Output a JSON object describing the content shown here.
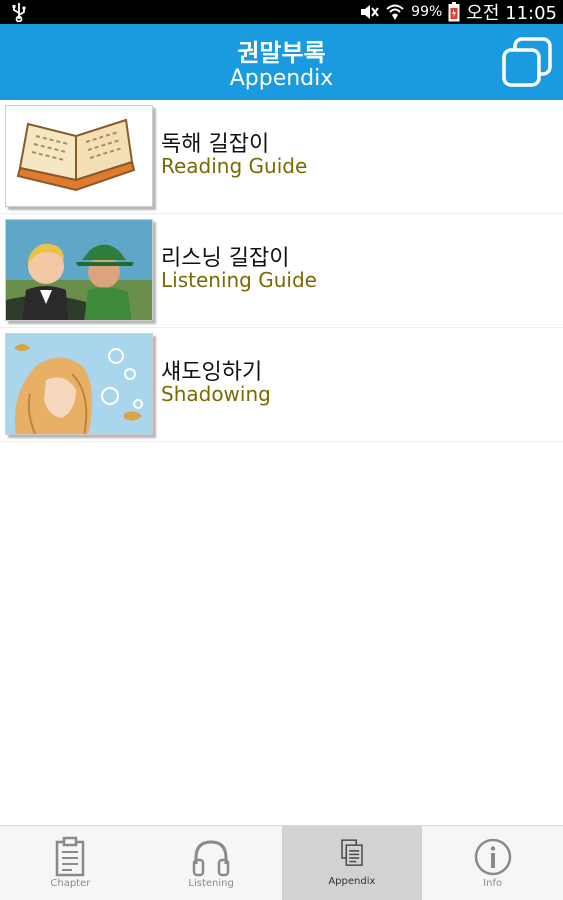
{
  "status_bar": {
    "battery_percent": "99%",
    "time": "오전 11:05",
    "icons": [
      "usb-icon",
      "mute-icon",
      "wifi-icon",
      "battery-icon"
    ]
  },
  "header": {
    "title_ko": "권말부록",
    "title_en": "Appendix",
    "action_icon": "copy-icon"
  },
  "list": {
    "items": [
      {
        "title_ko": "독해 길잡이",
        "title_en": "Reading Guide"
      },
      {
        "title_ko": "리스닝 길잡이",
        "title_en": "Listening Guide"
      },
      {
        "title_ko": "섀도잉하기",
        "title_en": "Shadowing"
      }
    ]
  },
  "bottom_nav": {
    "tabs": [
      {
        "label": "Chapter",
        "icon": "clipboard-icon",
        "selected": false
      },
      {
        "label": "Listening",
        "icon": "headphones-icon",
        "selected": false
      },
      {
        "label": "Appendix",
        "icon": "documents-icon",
        "selected": true
      },
      {
        "label": "Info",
        "icon": "info-icon",
        "selected": false
      }
    ]
  },
  "colors": {
    "header_bg": "#1a9be0",
    "english_subtitle": "#7a6a00",
    "active_tab_bg": "#d2d2d2"
  }
}
